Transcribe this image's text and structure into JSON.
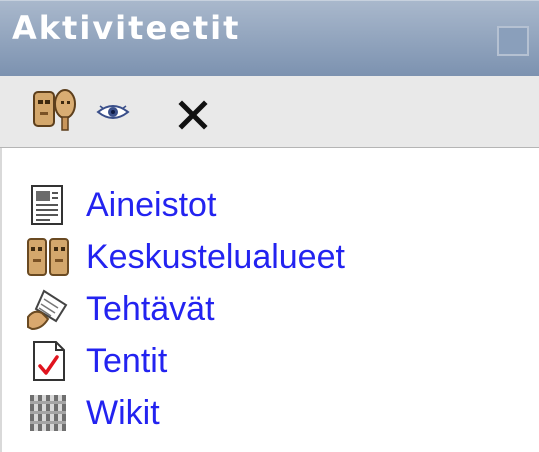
{
  "block": {
    "title": "Aktiviteetit",
    "colors": {
      "header_top": "#a9b8cc",
      "header_bottom": "#7c92b0",
      "toolbar_bg": "#e9e9e9",
      "link": "#2323f0"
    }
  },
  "toolbar": {
    "tools": [
      {
        "icon": "assign-roles-icon"
      },
      {
        "icon": "eye-icon"
      },
      {
        "icon": "close-icon"
      }
    ]
  },
  "activities": [
    {
      "label": "Aineistot",
      "icon": "resource-document-icon"
    },
    {
      "label": "Keskustelualueet",
      "icon": "forum-people-icon"
    },
    {
      "label": "Tehtävät",
      "icon": "assignment-hand-icon"
    },
    {
      "label": "Tentit",
      "icon": "quiz-checkmark-icon"
    },
    {
      "label": "Wikit",
      "icon": "wiki-icon"
    }
  ]
}
